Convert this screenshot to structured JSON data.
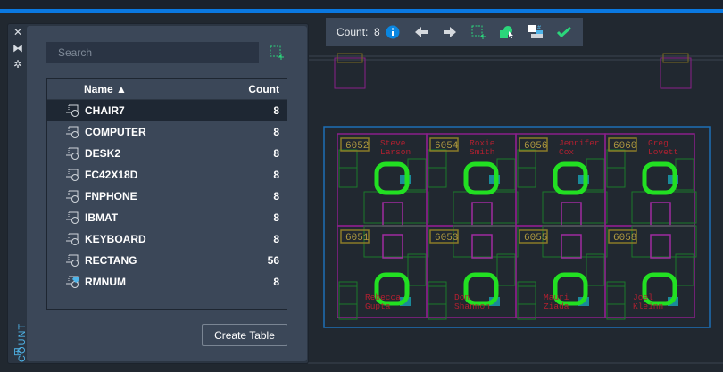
{
  "panel": {
    "title": "COUNT",
    "search_placeholder": "Search",
    "columns": {
      "name": "Name",
      "count": "Count"
    },
    "rows": [
      {
        "name": "CHAIR7",
        "count": "8",
        "selected": true
      },
      {
        "name": "COMPUTER",
        "count": "8"
      },
      {
        "name": "DESK2",
        "count": "8"
      },
      {
        "name": "FC42X18D",
        "count": "8"
      },
      {
        "name": "FNPHONE",
        "count": "8"
      },
      {
        "name": "IBMAT",
        "count": "8"
      },
      {
        "name": "KEYBOARD",
        "count": "8"
      },
      {
        "name": "RECTANG",
        "count": "56"
      },
      {
        "name": "RMNUM",
        "count": "8",
        "attribute": true
      }
    ],
    "create_table": "Create Table"
  },
  "toolbar": {
    "count_label": "Count:",
    "count_value": "8"
  },
  "drawing": {
    "cubicles": [
      {
        "room": "6052",
        "first": "Steve",
        "last": "Larson"
      },
      {
        "room": "6054",
        "first": "Roxie",
        "last": "Smith"
      },
      {
        "room": "6056",
        "first": "Jennifer",
        "last": "Cox"
      },
      {
        "room": "6060",
        "first": "Greg",
        "last": "Lovett"
      },
      {
        "room": "6051",
        "first": "Rebecca",
        "last": "Gupta"
      },
      {
        "room": "6053",
        "first": "Don",
        "last": "Shannon"
      },
      {
        "room": "6055",
        "first": "Mauri",
        "last": "Ziada"
      },
      {
        "room": "6058",
        "first": "Joel",
        "last": "Kleinn"
      }
    ]
  },
  "colors": {
    "accent": "#0a78e0",
    "green": "#2bd67b",
    "panel": "#3b4758"
  }
}
